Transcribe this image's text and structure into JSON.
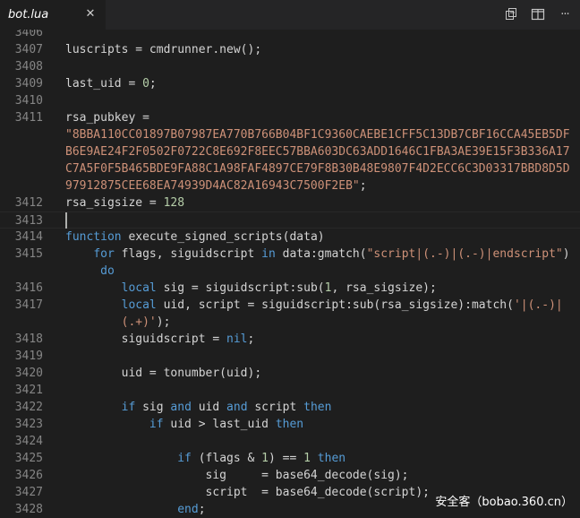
{
  "tab": {
    "title": "bot.lua",
    "close": "✕"
  },
  "actions": {
    "icons": [
      "open-changes-icon",
      "split-editor-icon",
      "more-actions-icon"
    ],
    "more_label": "···"
  },
  "colors": {
    "keyword": "#569cd6",
    "string": "#ce9178",
    "number": "#b5cea8",
    "text": "#d4d4d4",
    "line_number": "#858585"
  },
  "lines": [
    {
      "n": "3406",
      "code": []
    },
    {
      "n": "3407",
      "code": [
        {
          "t": "luscripts = cmdrunner.new();",
          "c": ""
        }
      ]
    },
    {
      "n": "3408",
      "code": []
    },
    {
      "n": "3409",
      "code": [
        {
          "t": "last_uid = ",
          "c": ""
        },
        {
          "t": "0",
          "c": "num"
        },
        {
          "t": ";",
          "c": ""
        }
      ]
    },
    {
      "n": "3410",
      "code": []
    },
    {
      "n": "3411",
      "code": [
        {
          "t": "rsa_pubkey =",
          "c": ""
        }
      ]
    },
    {
      "n": "",
      "code": [
        {
          "t": "\"8BBA110CC01897B07987EA770B766B04BF1C9360CAEBE1CFF5C13DB7CBF16CCA45EB5DF",
          "c": "str"
        }
      ]
    },
    {
      "n": "",
      "code": [
        {
          "t": "B6E9AE24F2F0502F0722C8E692F8EEC57BBA603DC63ADD1646C1FBA3AE39E15F3B336A17",
          "c": "str"
        }
      ]
    },
    {
      "n": "",
      "code": [
        {
          "t": "C7A5F0F5B465BDE9FA88C1A98FAF4897CE79F8B30B48E9807F4D2ECC6C3D03317BBD8D5D",
          "c": "str"
        }
      ]
    },
    {
      "n": "",
      "code": [
        {
          "t": "97912875CEE68EA74939D4AC82A16943C7500F2EB\"",
          "c": "str"
        },
        {
          "t": ";",
          "c": ""
        }
      ]
    },
    {
      "n": "3412",
      "code": [
        {
          "t": "rsa_sigsize = ",
          "c": ""
        },
        {
          "t": "128",
          "c": "num"
        }
      ]
    },
    {
      "n": "3413",
      "code": [],
      "current": true
    },
    {
      "n": "3414",
      "code": [
        {
          "t": "function",
          "c": "kw"
        },
        {
          "t": " execute_signed_scripts(data)",
          "c": ""
        }
      ]
    },
    {
      "n": "3415",
      "code": [
        {
          "t": "    ",
          "c": ""
        },
        {
          "t": "for",
          "c": "kw"
        },
        {
          "t": " flags, siguidscript ",
          "c": ""
        },
        {
          "t": "in",
          "c": "kw"
        },
        {
          "t": " data:gmatch(",
          "c": ""
        },
        {
          "t": "\"script|(.-)|(.-)|endscript\"",
          "c": "str"
        },
        {
          "t": ")",
          "c": ""
        }
      ]
    },
    {
      "n": "",
      "code": [
        {
          "t": "     ",
          "c": ""
        },
        {
          "t": "do",
          "c": "kw"
        }
      ]
    },
    {
      "n": "3416",
      "code": [
        {
          "t": "        ",
          "c": ""
        },
        {
          "t": "local",
          "c": "kw"
        },
        {
          "t": " sig = siguidscript:sub(",
          "c": ""
        },
        {
          "t": "1",
          "c": "num"
        },
        {
          "t": ", rsa_sigsize);",
          "c": ""
        }
      ]
    },
    {
      "n": "3417",
      "code": [
        {
          "t": "        ",
          "c": ""
        },
        {
          "t": "local",
          "c": "kw"
        },
        {
          "t": " uid, script = siguidscript:sub(rsa_sigsize):match(",
          "c": ""
        },
        {
          "t": "'|(.-)|",
          "c": "str"
        }
      ]
    },
    {
      "n": "",
      "code": [
        {
          "t": "        ",
          "c": ""
        },
        {
          "t": "(.+)'",
          "c": "str"
        },
        {
          "t": ");",
          "c": ""
        }
      ]
    },
    {
      "n": "3418",
      "code": [
        {
          "t": "        siguidscript = ",
          "c": ""
        },
        {
          "t": "nil",
          "c": "kw"
        },
        {
          "t": ";",
          "c": ""
        }
      ]
    },
    {
      "n": "3419",
      "code": []
    },
    {
      "n": "3420",
      "code": [
        {
          "t": "        uid = tonumber(uid);",
          "c": ""
        }
      ]
    },
    {
      "n": "3421",
      "code": []
    },
    {
      "n": "3422",
      "code": [
        {
          "t": "        ",
          "c": ""
        },
        {
          "t": "if",
          "c": "kw"
        },
        {
          "t": " sig ",
          "c": ""
        },
        {
          "t": "and",
          "c": "kw"
        },
        {
          "t": " uid ",
          "c": ""
        },
        {
          "t": "and",
          "c": "kw"
        },
        {
          "t": " script ",
          "c": ""
        },
        {
          "t": "then",
          "c": "kw"
        }
      ]
    },
    {
      "n": "3423",
      "code": [
        {
          "t": "            ",
          "c": ""
        },
        {
          "t": "if",
          "c": "kw"
        },
        {
          "t": " uid > last_uid ",
          "c": ""
        },
        {
          "t": "then",
          "c": "kw"
        }
      ]
    },
    {
      "n": "3424",
      "code": []
    },
    {
      "n": "3425",
      "code": [
        {
          "t": "                ",
          "c": ""
        },
        {
          "t": "if",
          "c": "kw"
        },
        {
          "t": " (flags & ",
          "c": ""
        },
        {
          "t": "1",
          "c": "num"
        },
        {
          "t": ") == ",
          "c": ""
        },
        {
          "t": "1",
          "c": "num"
        },
        {
          "t": " ",
          "c": ""
        },
        {
          "t": "then",
          "c": "kw"
        }
      ]
    },
    {
      "n": "3426",
      "code": [
        {
          "t": "                    sig     = base64_decode(sig);",
          "c": ""
        }
      ]
    },
    {
      "n": "3427",
      "code": [
        {
          "t": "                    script  = base64_decode(script);",
          "c": ""
        }
      ]
    },
    {
      "n": "3428",
      "code": [
        {
          "t": "                ",
          "c": ""
        },
        {
          "t": "end",
          "c": "kw"
        },
        {
          "t": ";",
          "c": ""
        }
      ]
    }
  ],
  "watermark": "安全客（bobao.360.cn）"
}
